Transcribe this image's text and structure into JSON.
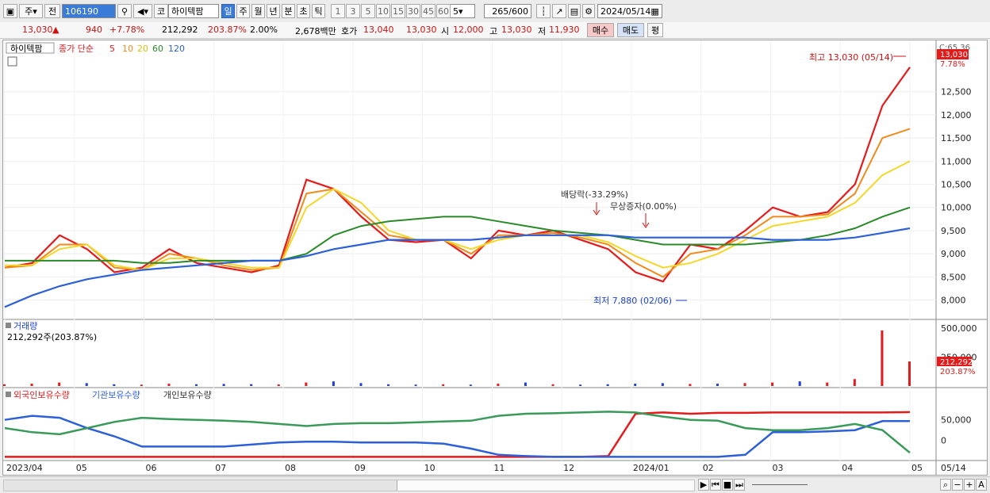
{
  "toolbar": {
    "type_sel": "주",
    "prev_label": "전",
    "code": "106190",
    "name_prefix": "코",
    "name": "하이텍팜",
    "periods": [
      "일",
      "주",
      "월",
      "년",
      "분",
      "초",
      "틱"
    ],
    "period_selected": "일",
    "counts": [
      "1",
      "3",
      "5",
      "10",
      "15",
      "30",
      "45",
      "60"
    ],
    "count_sel": "5",
    "view": "265",
    "view_total": "/600",
    "date": "2024/05/14"
  },
  "quote": {
    "price": "13,030",
    "change_arrow": "▲",
    "change": "940",
    "change_pct": "+7.78%",
    "volume": "212,292",
    "volume_pct": "203.87%",
    "turnover_pct": "2.00%",
    "amount": "2,678백만",
    "hoga_label": "호가",
    "bid": "13,040",
    "ask": "13,030",
    "open_label": "시",
    "open": "12,000",
    "high_label": "고",
    "high": "13,030",
    "low_label": "저",
    "low": "11,930",
    "buy_btn": "매수",
    "sell_btn": "매도",
    "eval_btn": "평"
  },
  "price_panel": {
    "name": "하이텍팜",
    "ma_label": "종가 단순",
    "ma_periods": [
      "5",
      "10",
      "20",
      "60",
      "120"
    ],
    "corner_label": "C:65.36",
    "current_price_tag": "13,030",
    "current_pct_tag": "7.78%",
    "high_note": "최고 13,030 (05/14)",
    "low_note": "최저 7,880 (02/06)",
    "event_dividend": "배당락(-33.29%)",
    "event_bonus": "무상증자(0.00%)"
  },
  "volume_panel": {
    "title": "거래량",
    "info": "212,292주(203.87%)",
    "current_tag": "212,292",
    "current_pct_tag": "203.87%"
  },
  "holdings_panel": {
    "labels": [
      "외국인보유수량",
      "기관보유수량",
      "개인보유수량"
    ]
  },
  "colors": {
    "up": "#e31b1b",
    "down": "#1f3fd8",
    "ma5": "#e31b1b",
    "ma10": "#f08a1c",
    "ma20": "#f3d72a",
    "ma60": "#2a8a2a",
    "ma120": "#2c5fd8",
    "foreign": "#e31b1b",
    "institution": "#2c5fd8",
    "individual": "#3a9a5a"
  },
  "chart_data": [
    {
      "type": "line",
      "title": "하이텍팜 일봉",
      "y_ticks": [
        8000,
        8500,
        9000,
        9500,
        10000,
        10500,
        11000,
        11500,
        12000,
        12500
      ],
      "ylim": [
        7650,
        13300
      ],
      "x_labels": [
        "2023/04",
        "05",
        "06",
        "07",
        "08",
        "09",
        "10",
        "11",
        "12",
        "2024/01",
        "02",
        "03",
        "04",
        "05",
        "05/14"
      ],
      "series": [
        {
          "name": "5",
          "values": [
            8700,
            8800,
            9400,
            9100,
            8600,
            8700,
            9100,
            8800,
            8700,
            8600,
            8750,
            10600,
            10400,
            9800,
            9300,
            9250,
            9300,
            8900,
            9500,
            9400,
            9500,
            9300,
            9100,
            8600,
            8400,
            9200,
            9100,
            9500,
            10000,
            9800,
            9900,
            10500,
            12200,
            13030
          ]
        },
        {
          "name": "10",
          "values": [
            8700,
            8750,
            9200,
            9200,
            8700,
            8650,
            9000,
            8900,
            8750,
            8650,
            8700,
            10300,
            10400,
            9900,
            9400,
            9300,
            9300,
            9000,
            9400,
            9400,
            9450,
            9350,
            9200,
            8800,
            8500,
            9000,
            9100,
            9400,
            9800,
            9800,
            9850,
            10300,
            11500,
            11700
          ]
        },
        {
          "name": "20",
          "values": [
            8750,
            8750,
            9100,
            9200,
            8750,
            8650,
            8900,
            8900,
            8800,
            8700,
            8700,
            10000,
            10400,
            10100,
            9500,
            9300,
            9300,
            9100,
            9300,
            9400,
            9400,
            9400,
            9250,
            8950,
            8700,
            8800,
            9000,
            9300,
            9600,
            9700,
            9800,
            10100,
            10700,
            11000
          ]
        },
        {
          "name": "60",
          "values": [
            8850,
            8850,
            8850,
            8850,
            8850,
            8800,
            8800,
            8850,
            8850,
            8850,
            8850,
            9000,
            9400,
            9600,
            9700,
            9750,
            9800,
            9800,
            9700,
            9600,
            9500,
            9450,
            9400,
            9300,
            9200,
            9200,
            9200,
            9200,
            9250,
            9300,
            9400,
            9550,
            9800,
            10000
          ]
        },
        {
          "name": "120",
          "values": [
            7850,
            8100,
            8300,
            8450,
            8550,
            8650,
            8700,
            8750,
            8800,
            8850,
            8850,
            8950,
            9100,
            9200,
            9300,
            9300,
            9300,
            9300,
            9350,
            9400,
            9400,
            9400,
            9400,
            9350,
            9350,
            9350,
            9350,
            9350,
            9300,
            9300,
            9300,
            9350,
            9450,
            9550
          ]
        }
      ]
    },
    {
      "type": "bar",
      "title": "거래량",
      "y_ticks": [
        250000,
        500000
      ],
      "ylim": [
        0,
        520000
      ],
      "values": [
        15000,
        20000,
        30000,
        25000,
        15000,
        12000,
        20000,
        15000,
        18000,
        16000,
        14000,
        30000,
        40000,
        25000,
        15000,
        12000,
        15000,
        12000,
        20000,
        30000,
        15000,
        12000,
        15000,
        20000,
        25000,
        18000,
        20000,
        25000,
        30000,
        40000,
        30000,
        60000,
        480000,
        212292
      ]
    },
    {
      "type": "line",
      "title": "보유수량",
      "y_ticks": [
        0,
        50000
      ],
      "ylim": [
        -45000,
        90000
      ],
      "series": [
        {
          "name": "외국인보유수량",
          "values": [
            -40000,
            -40000,
            -40000,
            -40000,
            -40000,
            -40000,
            -40000,
            -40000,
            -40000,
            -40000,
            -40000,
            -40000,
            -40000,
            -40000,
            -40000,
            -40000,
            -40000,
            -40000,
            -40000,
            -40000,
            -40000,
            -40000,
            -38000,
            65000,
            68000,
            65000,
            67000,
            67000,
            68000,
            68000,
            68000,
            68000,
            68000,
            69000
          ]
        },
        {
          "name": "기관보유수량",
          "values": [
            50000,
            60000,
            55000,
            30000,
            10000,
            -15000,
            -15000,
            -15000,
            -15000,
            -10000,
            -5000,
            -3000,
            -3000,
            -5000,
            -5000,
            -5000,
            -8000,
            -20000,
            -35000,
            -38000,
            -40000,
            -40000,
            -40000,
            -40000,
            -40000,
            -40000,
            -40000,
            -35000,
            20000,
            20000,
            22000,
            25000,
            47000,
            47000
          ]
        },
        {
          "name": "개인보유수량",
          "values": [
            30000,
            20000,
            15000,
            30000,
            45000,
            55000,
            52000,
            50000,
            48000,
            45000,
            40000,
            35000,
            40000,
            42000,
            42000,
            44000,
            46000,
            48000,
            60000,
            65000,
            66000,
            68000,
            70000,
            68000,
            58000,
            50000,
            48000,
            30000,
            25000,
            25000,
            30000,
            40000,
            25000,
            -30000
          ]
        }
      ]
    }
  ]
}
